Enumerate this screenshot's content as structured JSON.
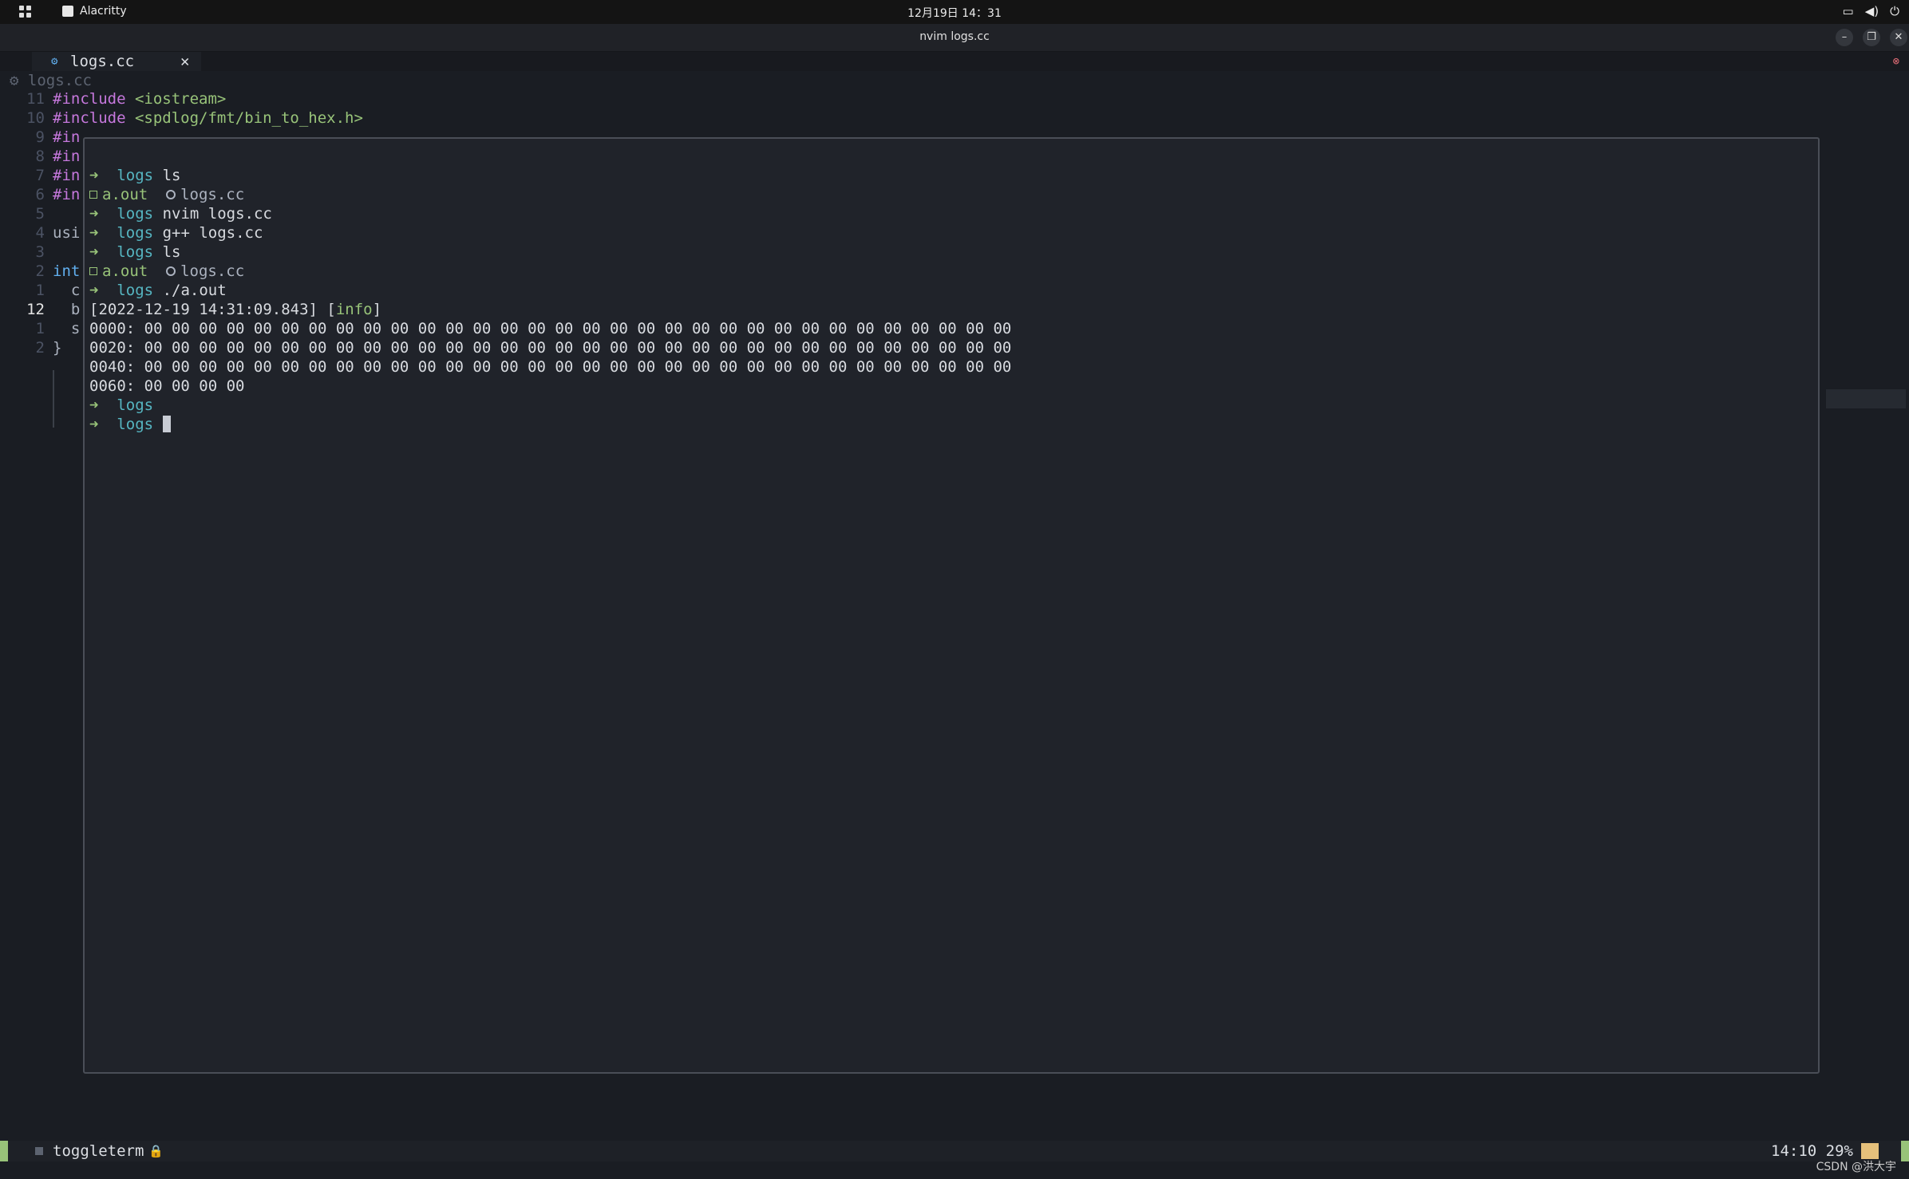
{
  "topbar": {
    "app_name": "Alacritty",
    "clock": "12月19日 14：31",
    "tray": [
      "▭",
      "◀)",
      "⏻"
    ]
  },
  "window": {
    "title": "nvim logs.cc",
    "buttons": [
      "–",
      "❐",
      "✕"
    ]
  },
  "tabline": {
    "tab_icon": "⚙",
    "tab_name": "logs.cc",
    "tab_close": "✕",
    "error_icon": "⊗"
  },
  "winbar": "⚙ logs.cc",
  "editor": {
    "lines": [
      {
        "num": "11",
        "kw": "#include",
        "rest": " <iostream>"
      },
      {
        "num": "10",
        "kw": "#include",
        "rest": " <spdlog/fmt/bin_to_hex.h>"
      },
      {
        "num": "9",
        "kw": "#in",
        "rest": ""
      },
      {
        "num": "8",
        "kw": "#in",
        "rest": ""
      },
      {
        "num": "7",
        "kw": "#in",
        "rest": ""
      },
      {
        "num": "6",
        "kw": "#in",
        "rest": ""
      },
      {
        "num": "5",
        "kw": "",
        "rest": ""
      },
      {
        "num": "4",
        "kw": "",
        "rest": "usi"
      },
      {
        "num": "3",
        "kw": "",
        "rest": ""
      },
      {
        "num": "2",
        "kw": "int",
        "rest": ""
      },
      {
        "num": "1",
        "kw": "",
        "rest": "  c"
      },
      {
        "num": "12",
        "kw": "",
        "rest": "  b",
        "current": true
      },
      {
        "num": "1",
        "kw": "",
        "rest": "  s"
      },
      {
        "num": "2",
        "kw": "",
        "rest": "}"
      }
    ]
  },
  "terminal": {
    "prompt_arrow": "➜",
    "cwd": "logs",
    "commands": [
      "ls",
      "nvim logs.cc",
      "g++ logs.cc",
      "ls",
      "./a.out"
    ],
    "ls_output": {
      "exe": "a.out",
      "file": "logs.cc"
    },
    "log_timestamp": "[2022-12-19 14:31:09.843] [",
    "log_level": "info",
    "log_close": "]",
    "hex_lines": [
      "0000: 00 00 00 00 00 00 00 00 00 00 00 00 00 00 00 00 00 00 00 00 00 00 00 00 00 00 00 00 00 00 00 00",
      "0020: 00 00 00 00 00 00 00 00 00 00 00 00 00 00 00 00 00 00 00 00 00 00 00 00 00 00 00 00 00 00 00 00",
      "0040: 00 00 00 00 00 00 00 00 00 00 00 00 00 00 00 00 00 00 00 00 00 00 00 00 00 00 00 00 00 00 00 00",
      "0060: 00 00 00 00"
    ]
  },
  "status": {
    "buffer_name": "toggleterm",
    "lock_icon": "🔒",
    "position": "14:10  29%"
  },
  "watermark": "CSDN @洪大宇"
}
